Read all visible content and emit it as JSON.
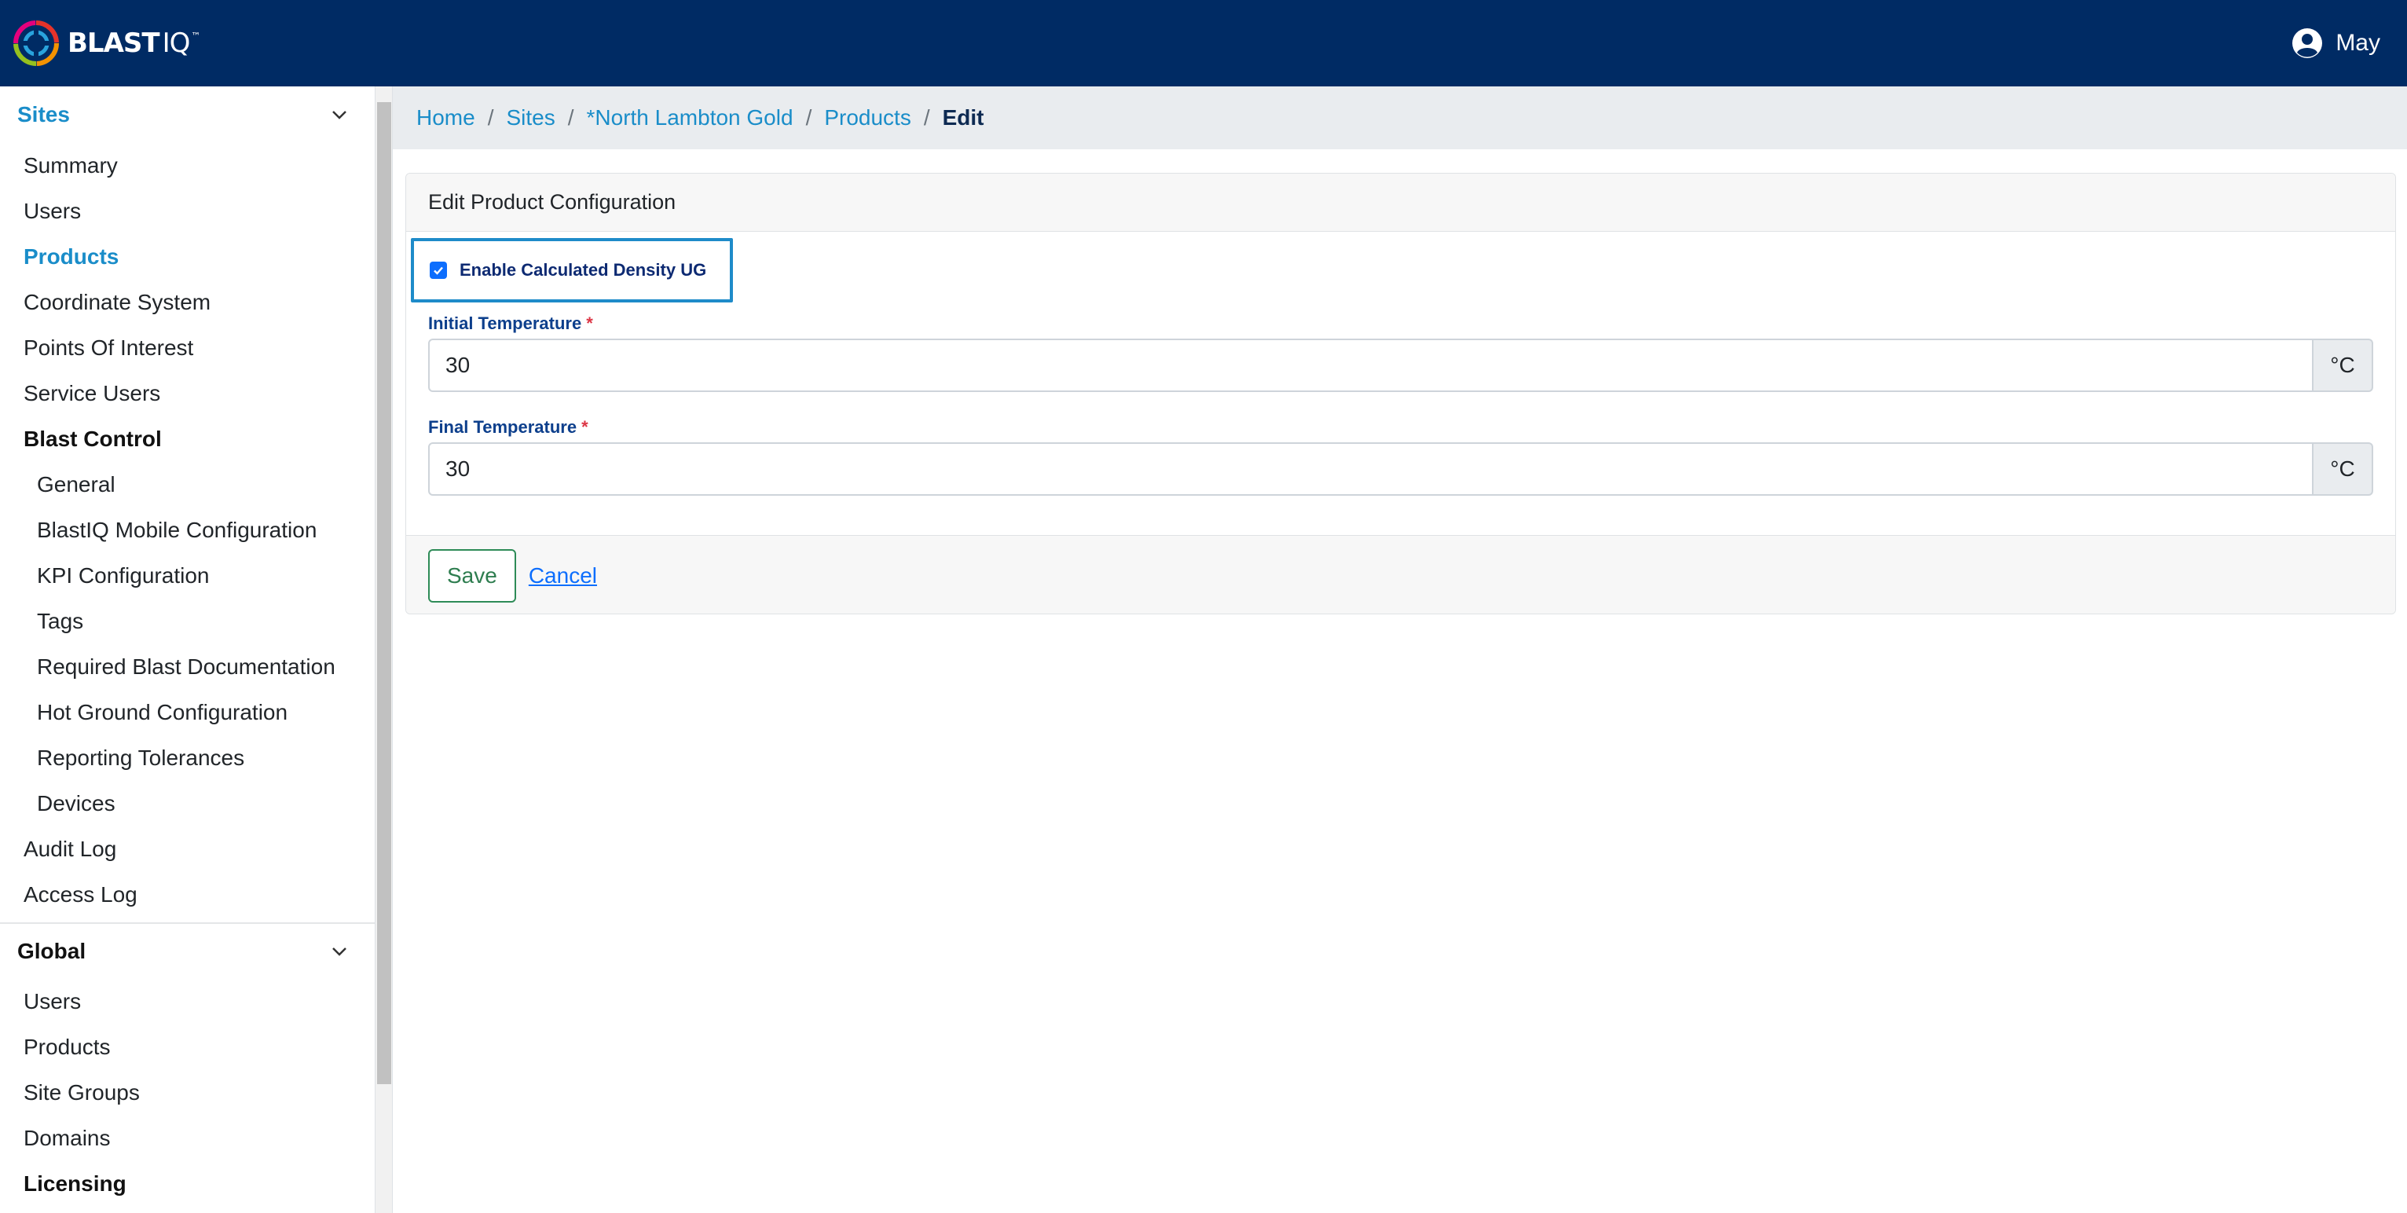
{
  "header": {
    "brand_bold": "BLAST",
    "brand_light": "IQ",
    "brand_tm": "™",
    "user_name": "May",
    "logo_icon": "blastiq-logo-icon",
    "user_icon": "user-circle-icon"
  },
  "sidebar": {
    "sites_title": "Sites",
    "sites_items": [
      {
        "label": "Summary"
      },
      {
        "label": "Users"
      },
      {
        "label": "Products"
      },
      {
        "label": "Coordinate System"
      },
      {
        "label": "Points Of Interest"
      },
      {
        "label": "Service Users"
      },
      {
        "label": "Blast Control"
      },
      {
        "label": "General"
      },
      {
        "label": "BlastIQ Mobile Configuration"
      },
      {
        "label": "KPI Configuration"
      },
      {
        "label": "Tags"
      },
      {
        "label": "Required Blast Documentation"
      },
      {
        "label": "Hot Ground Configuration"
      },
      {
        "label": "Reporting Tolerances"
      },
      {
        "label": "Devices"
      },
      {
        "label": "Audit Log"
      },
      {
        "label": "Access Log"
      }
    ],
    "global_title": "Global",
    "global_items": [
      {
        "label": "Users"
      },
      {
        "label": "Products"
      },
      {
        "label": "Site Groups"
      },
      {
        "label": "Domains"
      },
      {
        "label": "Licensing"
      }
    ]
  },
  "breadcrumb": {
    "items": [
      "Home",
      "Sites",
      "*North Lambton Gold",
      "Products"
    ],
    "current": "Edit",
    "separator": "/"
  },
  "form": {
    "title": "Edit Product Configuration",
    "checkbox_label": "Enable Calculated Density UG",
    "checkbox_checked": true,
    "initial_temp_label": "Initial Temperature",
    "initial_temp_value": "30",
    "final_temp_label": "Final Temperature",
    "final_temp_value": "30",
    "required_marker": "*",
    "unit": "°C",
    "save_label": "Save",
    "cancel_label": "Cancel"
  },
  "colors": {
    "header_bg": "#002b64",
    "accent": "#1a8dc9",
    "save_border": "#2e8b57"
  }
}
